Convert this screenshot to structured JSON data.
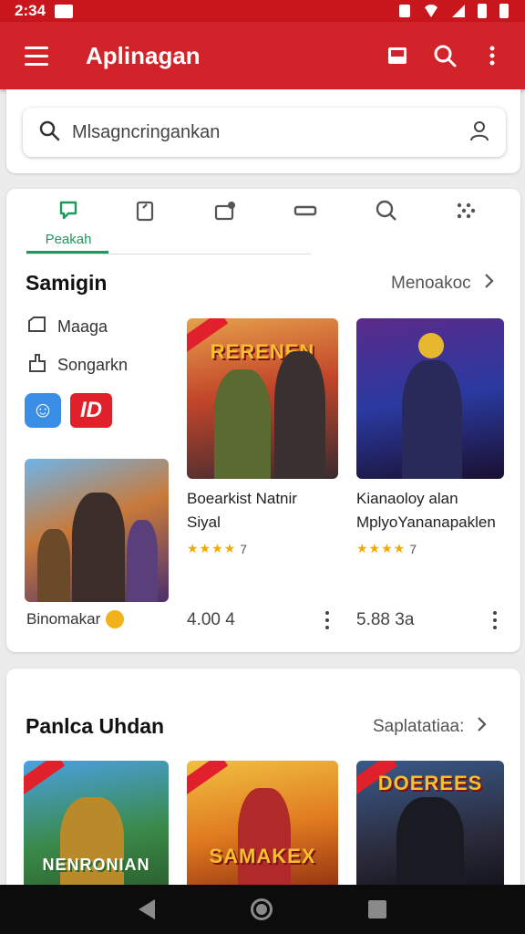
{
  "status_bar": {
    "time": "2:34"
  },
  "app_bar": {
    "title": "Aplinagan"
  },
  "search": {
    "placeholder": "Mlsagncringankan"
  },
  "tabs": [
    {
      "label": "Peakah",
      "icon": "chat-bubble-icon",
      "active": true
    },
    {
      "label": "",
      "icon": "clipboard-icon"
    },
    {
      "label": "",
      "icon": "briefcase-icon"
    },
    {
      "label": "",
      "icon": "rectangle-icon"
    },
    {
      "label": "",
      "icon": "search-icon"
    },
    {
      "label": "",
      "icon": "dots-grid-icon"
    }
  ],
  "section1": {
    "title": "Samigin",
    "more": "Menoakoc",
    "side_items": [
      {
        "label": "Maaga",
        "icon": "tag-icon"
      },
      {
        "label": "Songarkn",
        "icon": "share-icon"
      }
    ],
    "badges": {
      "blue": "☺",
      "red": "ID"
    },
    "small_game": {
      "name": "Binomakar"
    },
    "games": [
      {
        "name_line1": "Boearkist Natnir",
        "name_line2": "Siyal",
        "stars": "★★★★",
        "rating": "7",
        "price": "4.00 4",
        "thumb_text": "RERENEN"
      },
      {
        "name_line1": "Kianaoloy alan",
        "name_line2": "MplyoYananapaklen",
        "stars": "★★★★",
        "rating": "7",
        "price": "5.88 3a",
        "thumb_text": ""
      }
    ]
  },
  "section2": {
    "title": "Panlca Uhdan",
    "more": "Saplatatiaa:",
    "thumbs": [
      {
        "text": "NENRONIAN"
      },
      {
        "text": "SAMAKEX"
      },
      {
        "text": "DOEREES"
      }
    ]
  },
  "colors": {
    "primary": "#d2222a",
    "accent": "#1b9a5e",
    "star": "#f2a900"
  }
}
